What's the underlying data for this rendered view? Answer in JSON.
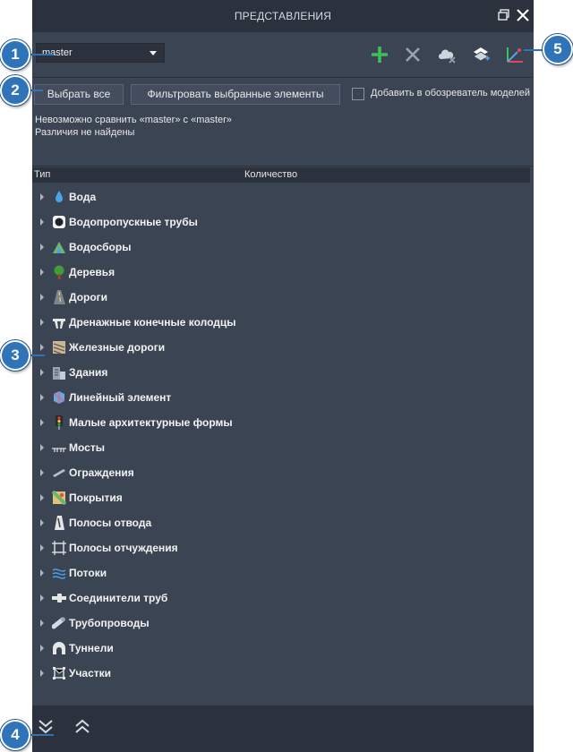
{
  "window": {
    "title": "ПРЕДСТАВЛЕНИЯ"
  },
  "toolbar": {
    "branch_selected": "master",
    "tool_icons": [
      "add-icon",
      "delete-icon",
      "cloud-icon",
      "layers-icon",
      "axes-icon"
    ]
  },
  "actions": {
    "select_all": "Выбрать все",
    "filter_selected": "Фильтровать выбранные элементы",
    "add_to_browser": "Добавить в обозреватель моделей"
  },
  "messages": {
    "compare": "Невозможно сравнить «master» с «master»",
    "no_diff": "Различия не найдены"
  },
  "columns": {
    "type": "Тип",
    "count": "Количество"
  },
  "tree": {
    "items": [
      {
        "label": "Вода",
        "icon": "water-icon"
      },
      {
        "label": "Водопропускные трубы",
        "icon": "culvert-icon"
      },
      {
        "label": "Водосборы",
        "icon": "catchment-icon"
      },
      {
        "label": "Деревья",
        "icon": "tree-icon"
      },
      {
        "label": "Дороги",
        "icon": "road-icon"
      },
      {
        "label": "Дренажные конечные колодцы",
        "icon": "drain-icon"
      },
      {
        "label": "Железные дороги",
        "icon": "railway-icon"
      },
      {
        "label": "Здания",
        "icon": "building-icon"
      },
      {
        "label": "Линейный элемент",
        "icon": "linear-element-icon"
      },
      {
        "label": "Малые архитектурные формы",
        "icon": "traffic-light-icon"
      },
      {
        "label": "Мосты",
        "icon": "bridge-icon"
      },
      {
        "label": "Ограждения",
        "icon": "barrier-icon"
      },
      {
        "label": "Покрытия",
        "icon": "coverage-icon"
      },
      {
        "label": "Полосы отвода",
        "icon": "right-of-way-icon"
      },
      {
        "label": "Полосы отчуждения",
        "icon": "easement-icon"
      },
      {
        "label": "Потоки",
        "icon": "stream-icon"
      },
      {
        "label": "Соединители труб",
        "icon": "pipe-connector-icon"
      },
      {
        "label": "Трубопроводы",
        "icon": "pipeline-icon"
      },
      {
        "label": "Туннели",
        "icon": "tunnel-icon"
      },
      {
        "label": "Участки",
        "icon": "parcel-icon"
      }
    ]
  },
  "footer": {
    "icons": [
      "expand-all-icon",
      "collapse-all-icon"
    ]
  },
  "callouts": [
    "1",
    "2",
    "3",
    "4",
    "5"
  ],
  "colors": {
    "panel_bg": "#3b4453",
    "header_bg": "#2b313d",
    "callout": "#2f73b8",
    "add_green": "#3fbf5a"
  }
}
